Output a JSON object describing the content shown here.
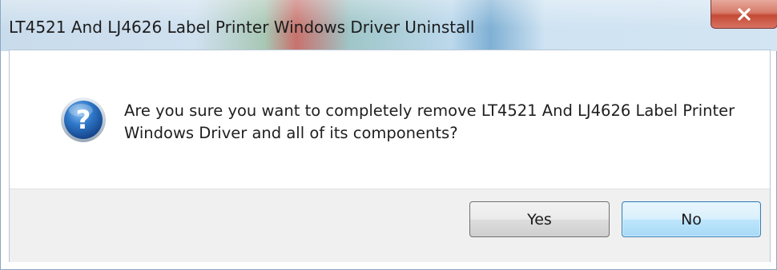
{
  "dialog": {
    "title": "LT4521 And LJ4626 Label Printer Windows Driver Uninstall",
    "message": "Are you sure you want to completely remove LT4521 And LJ4626 Label Printer Windows Driver and all of its components?",
    "icon": "question-icon",
    "close_icon": "close-icon"
  },
  "buttons": {
    "yes_label": "Yes",
    "no_label": "No"
  },
  "colors": {
    "close_button": "#c44a35",
    "default_button_border": "#3c7fb1",
    "button_area": "#f0f0f0",
    "question_icon_blue": "#1f5fa8"
  }
}
